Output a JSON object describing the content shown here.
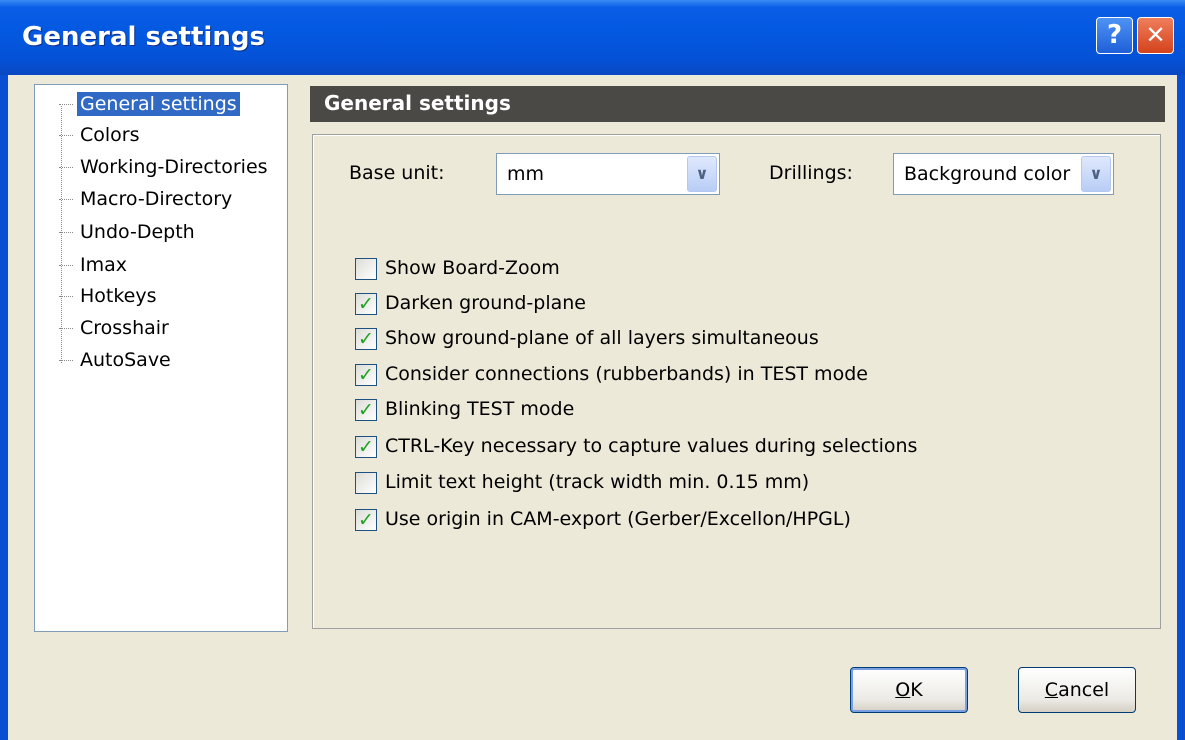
{
  "window": {
    "title": "General settings"
  },
  "titlebar": {
    "help_glyph": "?",
    "close_glyph": "✕"
  },
  "tree": {
    "items": [
      {
        "label": "General settings",
        "selected": true
      },
      {
        "label": "Colors"
      },
      {
        "label": "Working-Directories"
      },
      {
        "label": "Macro-Directory"
      },
      {
        "label": "Undo-Depth"
      },
      {
        "label": "Imax"
      },
      {
        "label": "Hotkeys"
      },
      {
        "label": "Crosshair"
      },
      {
        "label": "AutoSave"
      }
    ]
  },
  "panel": {
    "header": "General settings",
    "base_unit": {
      "label": "Base unit:",
      "value": "mm"
    },
    "drillings": {
      "label": "Drillings:",
      "value": "Background color"
    },
    "checkboxes": [
      {
        "label": "Show Board-Zoom",
        "checked": false
      },
      {
        "label": "Darken ground-plane",
        "checked": true
      },
      {
        "label": "Show ground-plane of all layers simultaneous",
        "checked": true
      },
      {
        "label": "Consider connections (rubberbands) in TEST mode",
        "checked": true
      },
      {
        "label": "Blinking TEST mode",
        "checked": true
      },
      {
        "label": "CTRL-Key necessary to capture values during selections",
        "checked": true
      },
      {
        "label": "Limit text height (track width min. 0.15 mm)",
        "checked": false
      },
      {
        "label": "Use origin in CAM-export (Gerber/Excellon/HPGL)",
        "checked": true
      }
    ]
  },
  "buttons": {
    "ok": {
      "accel": "O",
      "rest": "K"
    },
    "cancel": {
      "accel": "C",
      "rest": "ancel"
    }
  },
  "colors": {
    "titlebar": "#0358e0",
    "selection": "#316ac5",
    "dialog_bg": "#ece9d8",
    "panel_header": "#4a4946"
  }
}
